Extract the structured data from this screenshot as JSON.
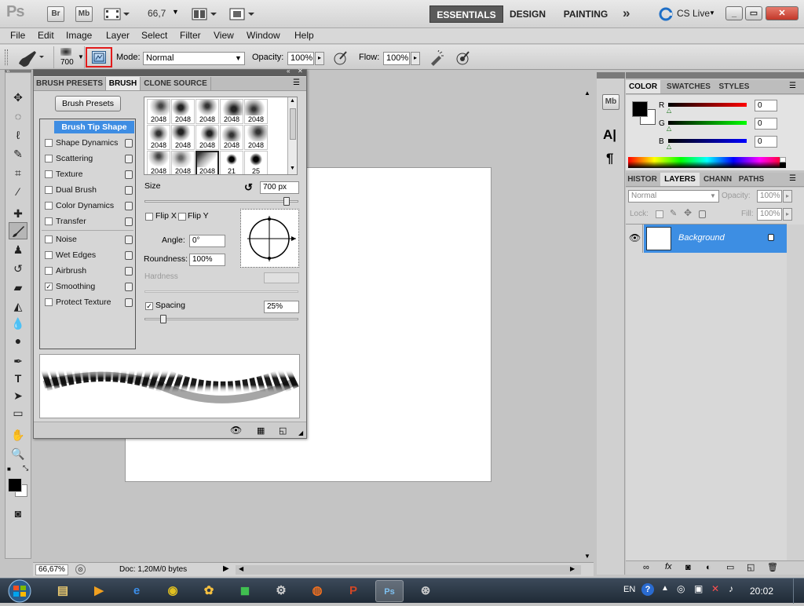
{
  "appbar": {
    "logo": "Ps",
    "bridge": "Br",
    "minibridge": "Mb",
    "zoom": "66,7",
    "workspaces": [
      "ESSENTIALS",
      "DESIGN",
      "PAINTING"
    ],
    "more": "»",
    "cslive": "CS Live",
    "window_buttons": [
      "_",
      "▭",
      "✕"
    ]
  },
  "menubar": [
    "File",
    "Edit",
    "Image",
    "Layer",
    "Select",
    "Filter",
    "View",
    "Window",
    "Help"
  ],
  "options": {
    "brush_size": "700",
    "mode_label": "Mode:",
    "mode_value": "Normal",
    "opacity_label": "Opacity:",
    "opacity_value": "100%",
    "flow_label": "Flow:",
    "flow_value": "100%",
    "highlight_color": "#e21b1b"
  },
  "brush_panel": {
    "tabs": [
      "BRUSH PRESETS",
      "BRUSH",
      "CLONE SOURCE"
    ],
    "presets_button": "Brush Presets",
    "options": [
      {
        "label": "Brush Tip Shape",
        "selected": true,
        "check": false
      },
      {
        "label": "Shape Dynamics",
        "check": false
      },
      {
        "label": "Scattering",
        "check": false
      },
      {
        "label": "Texture",
        "check": false
      },
      {
        "label": "Dual Brush",
        "check": false
      },
      {
        "label": "Color Dynamics",
        "check": false
      },
      {
        "label": "Transfer",
        "check": false
      },
      {
        "label": "Noise",
        "check": false
      },
      {
        "label": "Wet Edges",
        "check": false
      },
      {
        "label": "Airbrush",
        "check": false
      },
      {
        "label": "Smoothing",
        "check": true
      },
      {
        "label": "Protect Texture",
        "check": false
      }
    ],
    "tips_row1": [
      "2048",
      "2048",
      "2048",
      "2048",
      "2048"
    ],
    "tips_row2": [
      "2048",
      "2048",
      "2048",
      "2048",
      "2048"
    ],
    "tips_row3": [
      "2048",
      "2048",
      "2048",
      "21",
      "25"
    ],
    "size_label": "Size",
    "size_value": "700 px",
    "flip_x": "Flip X",
    "flip_y": "Flip Y",
    "angle_label": "Angle:",
    "angle_value": "0°",
    "roundness_label": "Roundness:",
    "roundness_value": "100%",
    "hardness_label": "Hardness",
    "spacing_label": "Spacing",
    "spacing_value": "25%"
  },
  "status": {
    "zoom": "66,67%",
    "doc": "Doc: 1,20M/0 bytes"
  },
  "color_panel": {
    "tabs": [
      "COLOR",
      "SWATCHES",
      "STYLES"
    ],
    "channels": [
      {
        "name": "R",
        "value": "0",
        "color": "#d40000"
      },
      {
        "name": "G",
        "value": "0",
        "color": "#00b000"
      },
      {
        "name": "B",
        "value": "0",
        "color": "#0000d0"
      }
    ]
  },
  "layers_panel": {
    "tabs": [
      "HISTOR",
      "LAYERS",
      "CHANN",
      "PATHS"
    ],
    "blend": "Normal",
    "opacity_label": "Opacity:",
    "opacity_value": "100%",
    "lock_label": "Lock:",
    "fill_label": "Fill:",
    "fill_value": "100%",
    "layer_name": "Background"
  },
  "taskbar": {
    "lang": "EN",
    "time": "20:02"
  }
}
